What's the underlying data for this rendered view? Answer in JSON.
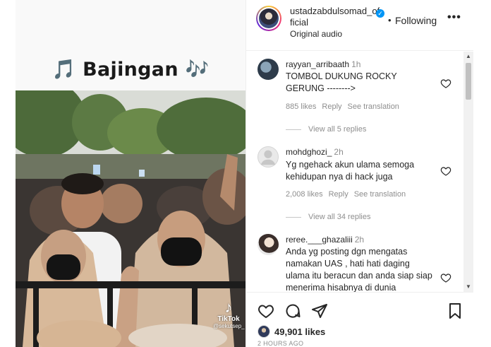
{
  "video": {
    "caption": "🎵 Bajingan 🎶",
    "watermark_brand": "TikTok",
    "watermark_user": "@sekutsep_"
  },
  "header": {
    "username": "ustadzabdulsomad_official",
    "separator": "•",
    "follow_label": "Following",
    "more_label": "•••",
    "audio_label": "Original audio"
  },
  "comments": [
    {
      "user": "rayyan_arribaath",
      "time": "1h",
      "text": "TOMBOL DUKUNG ROCKY GERUNG -------->",
      "likes": "885 likes",
      "reply": "Reply",
      "translate": "See translation",
      "view_replies": "View all 5 replies"
    },
    {
      "user": "mohdghozi_",
      "time": "2h",
      "text": "Yg ngehack akun ulama semoga kehidupan nya di hack juga",
      "likes": "2,008 likes",
      "reply": "Reply",
      "translate": "See translation",
      "view_replies": "View all 34 replies"
    },
    {
      "user": "reree.___ghazaliii",
      "time": "2h",
      "text": "Anda yg posting dgn mengatas namakan UAS , hati hati daging ulama itu beracun dan anda siap siap menerima hisabnya di dunia"
    }
  ],
  "footer": {
    "likes": "49,901 likes",
    "date": "2 HOURS AGO"
  },
  "colors": {
    "verified": "#0095f6",
    "text": "#262626",
    "muted": "#8e8e8e"
  }
}
